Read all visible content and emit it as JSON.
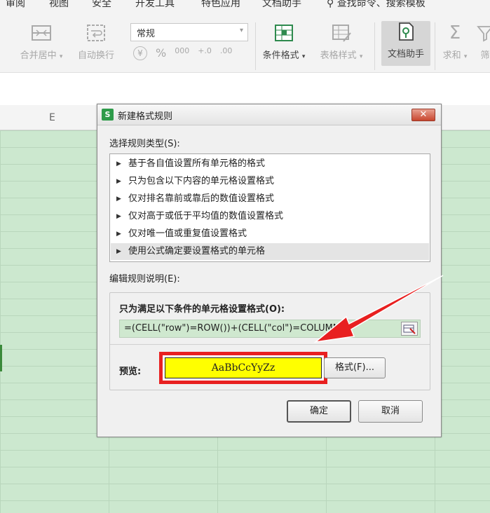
{
  "ribbon": {
    "tabs": [
      "审阅",
      "视图",
      "安全",
      "开发工具",
      "特色应用",
      "文档助手"
    ],
    "search_text": "查找命令、搜索模板",
    "buttons": {
      "merge": "合并居中",
      "wrap": "自动换行",
      "conditional_format": "条件格式",
      "table_style": "表格样式",
      "doc_helper": "文档助手",
      "sum": "求和",
      "more": "筛"
    },
    "number_format": "常规",
    "num_symbols": [
      "¥",
      "%",
      "000",
      "+.0",
      ".00"
    ]
  },
  "sheet": {
    "column_header": "E"
  },
  "dialog": {
    "title": "新建格式规则",
    "logo_letter": "S",
    "close_symbol": "✕",
    "rule_type_label": "选择规则类型(S):",
    "rules": [
      "基于各自值设置所有单元格的格式",
      "只为包含以下内容的单元格设置格式",
      "仅对排名靠前或靠后的数值设置格式",
      "仅对高于或低于平均值的数值设置格式",
      "仅对唯一值或重复值设置格式",
      "使用公式确定要设置格式的单元格"
    ],
    "edit_label": "编辑规则说明(E):",
    "condition_label": "只为满足以下条件的单元格设置格式(O):",
    "formula": "=(CELL(\"row\")=ROW())+(CELL(\"col\")=COLUMN())",
    "preview_label": "预览:",
    "preview_text": "AaBbCcYyZz",
    "format_button": "格式(F)...",
    "ok_button": "确定",
    "cancel_button": "取消"
  },
  "colors": {
    "preview_fill": "#ffff00",
    "highlight": "#e82020",
    "sheet_fill": "#cce8cf"
  }
}
